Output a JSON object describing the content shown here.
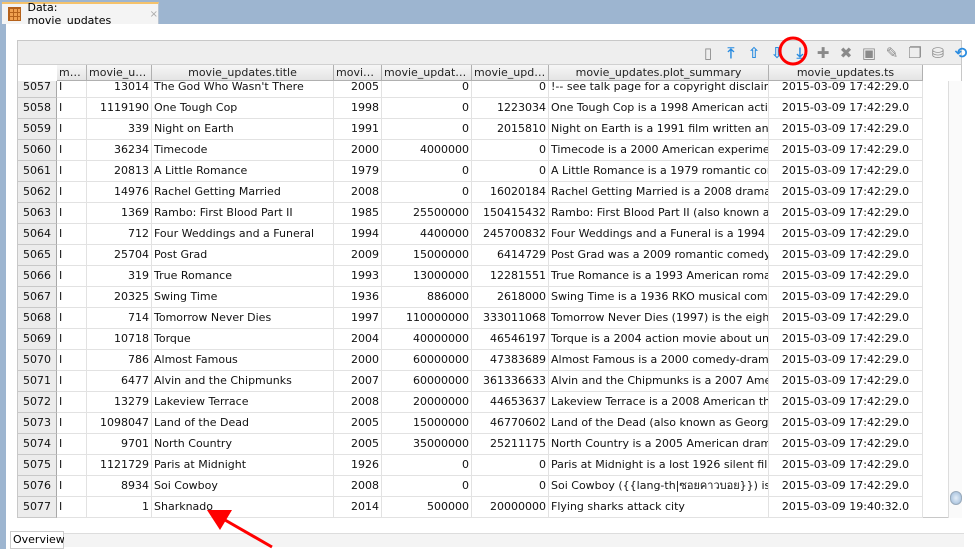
{
  "tab": {
    "title": "Data: movie_updates",
    "close": "×"
  },
  "toolbar": {
    "icons": [
      "database-icon",
      "first-row-icon",
      "previous-row-icon",
      "next-row-icon",
      "last-row-icon",
      "add-row-icon",
      "delete-row-icon",
      "save-icon",
      "edit-icon",
      "copy-icon",
      "commit-icon",
      "refresh-icon"
    ],
    "highlight": "last-row-icon",
    "highlight_color": "#ff0000"
  },
  "columns": [
    "mo...",
    "movie_up...",
    "movie_updates.title",
    "movie...",
    "movie_update...",
    "movie_upda...",
    "movie_updates.plot_summary",
    "movie_updates.ts"
  ],
  "rows": [
    [
      "5057",
      "I",
      "13014",
      "The God Who Wasn't There",
      "2005",
      "0",
      "0",
      "!-- see talk page for a copyright disclaim",
      "2015-03-09 17:42:29.0"
    ],
    [
      "5058",
      "I",
      "1119190",
      "One Tough Cop",
      "1998",
      "0",
      "1223034",
      "One Tough Cop is a 1998 American actic",
      "2015-03-09 17:42:29.0"
    ],
    [
      "5059",
      "I",
      "339",
      "Night on Earth",
      "1991",
      "0",
      "2015810",
      "Night on Earth is a 1991 film written and",
      "2015-03-09 17:42:29.0"
    ],
    [
      "5060",
      "I",
      "36234",
      "Timecode",
      "2000",
      "4000000",
      "0",
      "Timecode is a 2000 American experimen",
      "2015-03-09 17:42:29.0"
    ],
    [
      "5061",
      "I",
      "20813",
      "A Little Romance",
      "1979",
      "0",
      "0",
      "A Little Romance is a 1979 romantic com",
      "2015-03-09 17:42:29.0"
    ],
    [
      "5062",
      "I",
      "14976",
      "Rachel Getting Married",
      "2008",
      "0",
      "16020184",
      "Rachel Getting Married is a 2008 drama f",
      "2015-03-09 17:42:29.0"
    ],
    [
      "5063",
      "I",
      "1369",
      "Rambo: First Blood Part II",
      "1985",
      "25500000",
      "150415432",
      "Rambo: First Blood Part II (also known as",
      "2015-03-09 17:42:29.0"
    ],
    [
      "5064",
      "I",
      "712",
      "Four Weddings and a Funeral",
      "1994",
      "4400000",
      "245700832",
      "Four Weddings and a Funeral is a 1994 Bı",
      "2015-03-09 17:42:29.0"
    ],
    [
      "5065",
      "I",
      "25704",
      "Post Grad",
      "2009",
      "15000000",
      "6414729",
      "Post Grad was a 2009 romantic comedy f",
      "2015-03-09 17:42:29.0"
    ],
    [
      "5066",
      "I",
      "319",
      "True Romance",
      "1993",
      "13000000",
      "12281551",
      "True Romance is a 1993 American romar",
      "2015-03-09 17:42:29.0"
    ],
    [
      "5067",
      "I",
      "20325",
      "Swing Time",
      "1936",
      "886000",
      "2618000",
      "Swing Time is a 1936 RKO musical comec",
      "2015-03-09 17:42:29.0"
    ],
    [
      "5068",
      "I",
      "714",
      "Tomorrow Never Dies",
      "1997",
      "110000000",
      "333011068",
      "Tomorrow Never Dies (1997) is the eight",
      "2015-03-09 17:42:29.0"
    ],
    [
      "5069",
      "I",
      "10718",
      "Torque",
      "2004",
      "40000000",
      "46546197",
      "Torque is a 2004 action movie about unc",
      "2015-03-09 17:42:29.0"
    ],
    [
      "5070",
      "I",
      "786",
      "Almost Famous",
      "2000",
      "60000000",
      "47383689",
      "Almost Famous is a 2000 comedy-drama",
      "2015-03-09 17:42:29.0"
    ],
    [
      "5071",
      "I",
      "6477",
      "Alvin and the Chipmunks",
      "2007",
      "60000000",
      "361336633",
      "Alvin and the Chipmunks is a 2007 Amer",
      "2015-03-09 17:42:29.0"
    ],
    [
      "5072",
      "I",
      "13279",
      "Lakeview Terrace",
      "2008",
      "20000000",
      "44653637",
      "Lakeview Terrace is a 2008 American thri",
      "2015-03-09 17:42:29.0"
    ],
    [
      "5073",
      "I",
      "1098047",
      "Land of the Dead",
      "2005",
      "15000000",
      "46770602",
      "Land of the Dead (also known as George .",
      "2015-03-09 17:42:29.0"
    ],
    [
      "5074",
      "I",
      "9701",
      "North Country",
      "2005",
      "35000000",
      "25211175",
      "North Country is a 2005 American drama",
      "2015-03-09 17:42:29.0"
    ],
    [
      "5075",
      "I",
      "1121729",
      "Paris at Midnight",
      "1926",
      "0",
      "0",
      "Paris at Midnight is a lost 1926 silent film",
      "2015-03-09 17:42:29.0"
    ],
    [
      "5076",
      "I",
      "8934",
      "Soi Cowboy",
      "2008",
      "0",
      "0",
      "Soi Cowboy ({{lang-th|ซอยคาวบอย}}) is a ",
      "2015-03-09 17:42:29.0"
    ],
    [
      "5077",
      "I",
      "1",
      "Sharknado",
      "2014",
      "500000",
      "20000000",
      "Flying sharks attack city",
      "2015-03-09 19:40:32.0"
    ]
  ],
  "bottom": {
    "overview_tab": "Overview"
  },
  "annotation": {
    "arrow_color": "#ff0000"
  }
}
